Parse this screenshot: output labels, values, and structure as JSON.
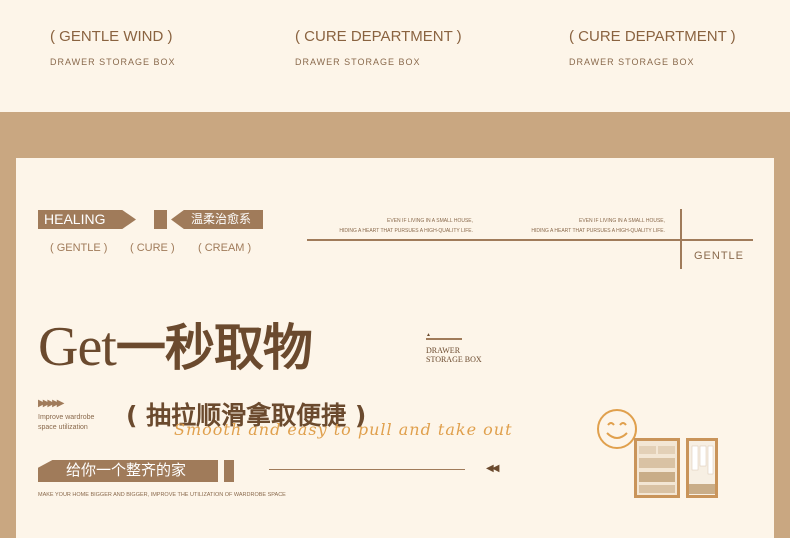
{
  "top": [
    {
      "title": "( GENTLE WIND )",
      "subtitle": "DRAWER STORAGE BOX"
    },
    {
      "title": "( CURE DEPARTMENT )",
      "subtitle": "DRAWER STORAGE BOX"
    },
    {
      "title": "( CURE DEPARTMENT )",
      "subtitle": "DRAWER STORAGE BOX"
    }
  ],
  "card": {
    "tag_healing": "HEALING",
    "tag_cn": "温柔治愈系",
    "subs": [
      "( GENTLE )",
      "( CURE )",
      "( CREAM )"
    ],
    "tiny_text_1": "EVEN IF LIVING IN A SMALL HOUSE,",
    "tiny_text_2": "HIDING A HEART THAT PURSUES A HIGH-QUALITY LIFE.",
    "gentle": "GENTLE",
    "headline_en": "Get",
    "headline_cn": "一秒取物",
    "drawer_1": "DRAWER",
    "drawer_2": "STORAGE BOX",
    "arrows": "▶▶▶▶▶",
    "improve_1": "Improve wardrobe",
    "improve_2": "space utilization",
    "subtitle_cn": "( 抽拉顺滑拿取便捷 )",
    "script": "Smooth and easy to pull and take out",
    "home_cn": "给你一个整齐的家",
    "rewind": "◀◀",
    "make_text": "MAKE YOUR HOME BIGGER AND BIGGER, IMPROVE THE UTILIZATION OF WARDROBE SPACE",
    "smiley": "smiley-face-icon",
    "wardrobe": "wardrobe-illustration"
  }
}
